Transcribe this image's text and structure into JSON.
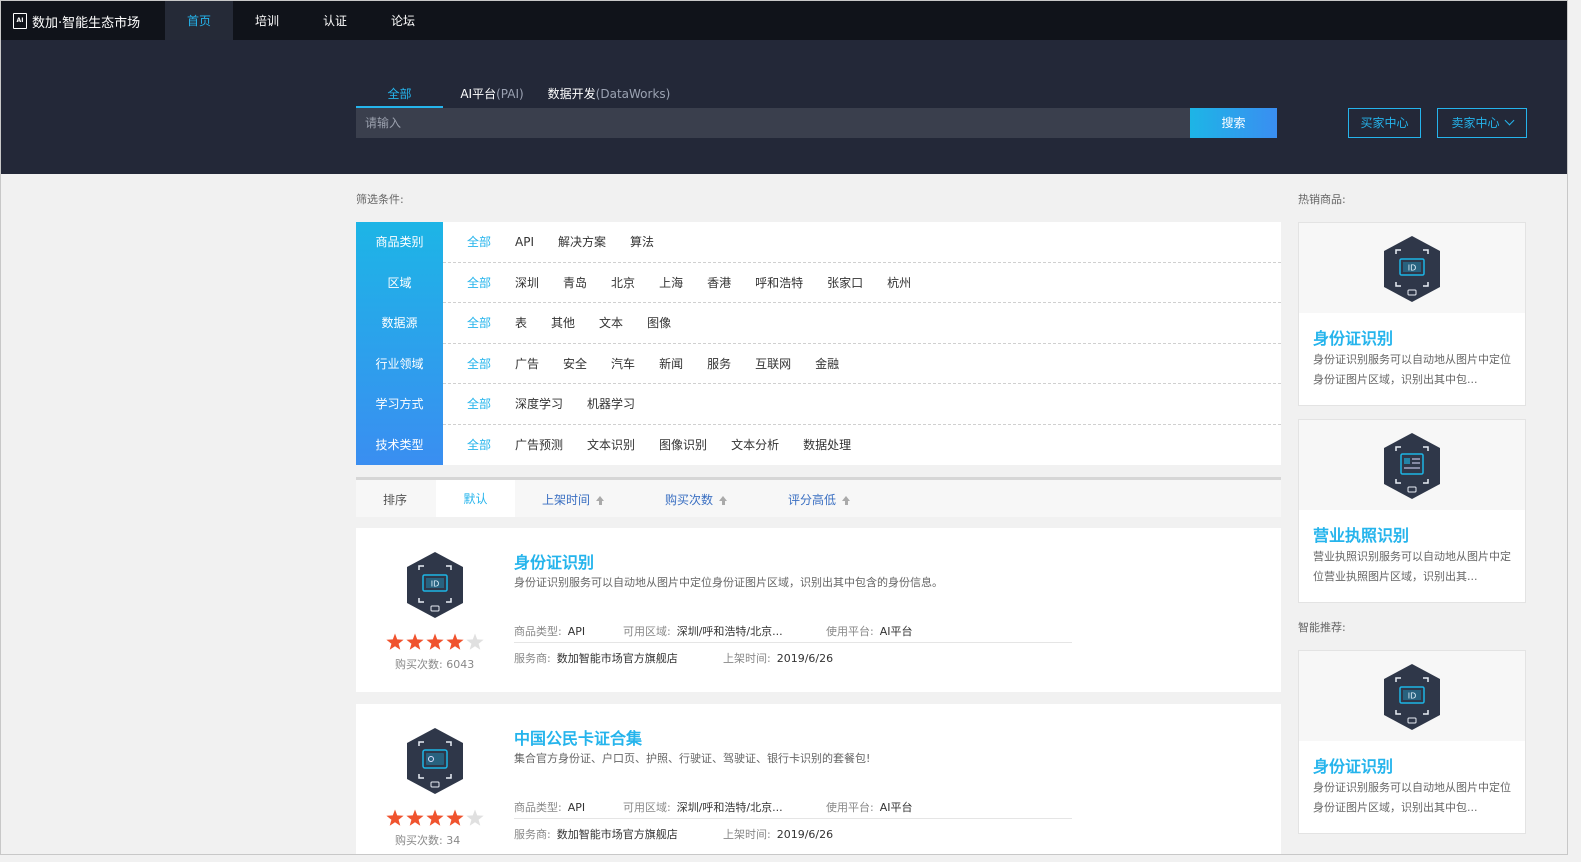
{
  "app": {
    "logo_text": "数加·智能生态市场",
    "logo_mark": "AI",
    "nav": [
      {
        "label": "首页",
        "active": true
      },
      {
        "label": "培训"
      },
      {
        "label": "认证"
      },
      {
        "label": "论坛"
      }
    ]
  },
  "search": {
    "tabs": [
      {
        "label": "全部",
        "sub": ""
      },
      {
        "label": "AI平台",
        "sub": "(PAI)"
      },
      {
        "label": "数据开发",
        "sub": "(DataWorks)"
      }
    ],
    "placeholder": "请输入",
    "button_label": "搜索",
    "buyer_center": "买家中心",
    "seller_center": "卖家中心"
  },
  "filters": {
    "title": "筛选条件:",
    "rows": [
      {
        "label": "商品类别",
        "options": [
          "全部",
          "API",
          "解决方案",
          "算法"
        ]
      },
      {
        "label": "区域",
        "options": [
          "全部",
          "深圳",
          "青岛",
          "北京",
          "上海",
          "香港",
          "呼和浩特",
          "张家口",
          "杭州"
        ]
      },
      {
        "label": "数据源",
        "options": [
          "全部",
          "表",
          "其他",
          "文本",
          "图像"
        ]
      },
      {
        "label": "行业领域",
        "options": [
          "全部",
          "广告",
          "安全",
          "汽车",
          "新闻",
          "服务",
          "互联网",
          "金融"
        ]
      },
      {
        "label": "学习方式",
        "options": [
          "全部",
          "深度学习",
          "机器学习"
        ]
      },
      {
        "label": "技术类型",
        "options": [
          "全部",
          "广告预测",
          "文本识别",
          "图像识别",
          "文本分析",
          "数据处理"
        ]
      }
    ]
  },
  "sort": {
    "label": "排序",
    "default": "默认",
    "items": [
      "上架时间",
      "购买次数",
      "评分高低"
    ]
  },
  "products": [
    {
      "title": "身份证识别",
      "desc": "身份证识别服务可以自动地从图片中定位身份证图片区域，识别出其中包含的身份信息。",
      "rating": 4,
      "buys": "购买次数: 6043",
      "type_label": "商品类型:",
      "type": "API",
      "region_label": "可用区域:",
      "region": "深圳/呼和浩特/北京...",
      "platform_label": "使用平台:",
      "platform": "AI平台",
      "vendor_label": "服务商:",
      "vendor": "数加智能市场官方旗舰店",
      "date_label": "上架时间:",
      "date": "2019/6/26",
      "icon": "id-card-icon"
    },
    {
      "title": "中国公民卡证合集",
      "desc": "集合官方身份证、户口页、护照、行驶证、驾驶证、银行卡识别的套餐包!",
      "rating": 4,
      "buys": "购买次数: 34",
      "type_label": "商品类型:",
      "type": "API",
      "region_label": "可用区域:",
      "region": "深圳/呼和浩特/北京...",
      "platform_label": "使用平台:",
      "platform": "AI平台",
      "vendor_label": "服务商:",
      "vendor": "数加智能市场官方旗舰店",
      "date_label": "上架时间:",
      "date": "2019/6/26",
      "icon": "card-collection-icon"
    }
  ],
  "sidebar": {
    "hot_title": "热销商品:",
    "hot": [
      {
        "name": "身份证识别",
        "desc": "身份证识别服务可以自动地从图片中定位身份证图片区域，识别出其中包...",
        "icon": "id-card-icon"
      },
      {
        "name": "营业执照识别",
        "desc": "营业执照识别服务可以自动地从图片中定位营业执照图片区域，识别出其...",
        "icon": "business-license-icon"
      }
    ],
    "rec_title": "智能推荐:",
    "rec": [
      {
        "name": "身份证识别",
        "desc": "身份证识别服务可以自动地从图片中定位身份证图片区域，识别出其中包...",
        "icon": "id-card-icon"
      }
    ]
  },
  "colors": {
    "accent": "#25b4ec",
    "topbar": "#10131a",
    "hero": "#232838",
    "star": "#f0532e"
  }
}
